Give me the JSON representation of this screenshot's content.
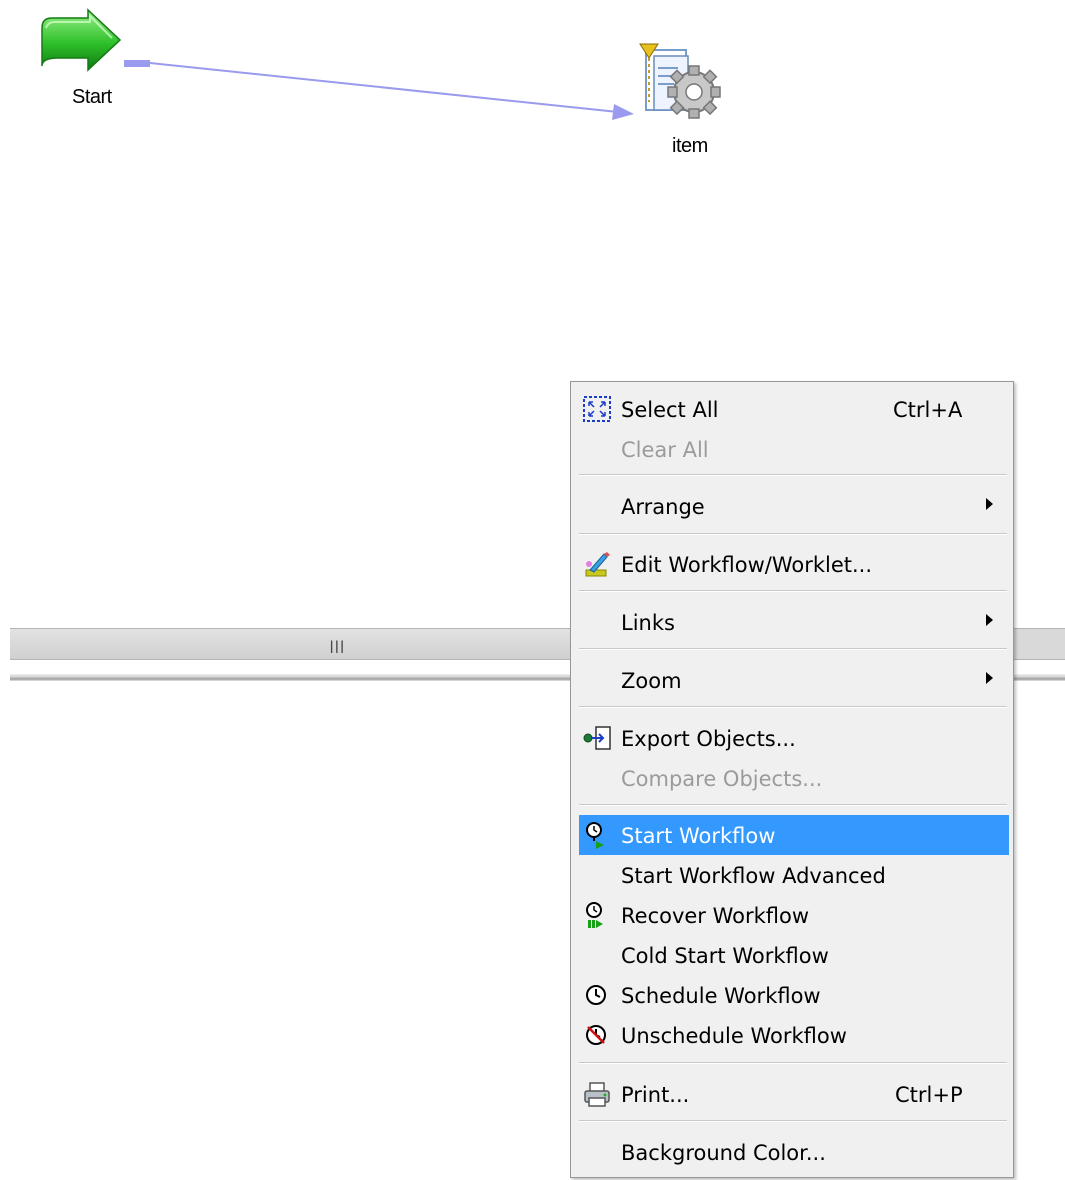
{
  "canvas": {
    "start_node_label": "Start",
    "session_node_label": "item"
  },
  "colors": {
    "link_line": "#9a9aee",
    "menu_highlight": "#3399ff",
    "menu_background": "#f0f0f0",
    "disabled_text": "#9b9b9b"
  },
  "context_menu": {
    "select_all": {
      "label": "Select All",
      "shortcut": "Ctrl+A",
      "icon": "select-all-icon"
    },
    "clear_all": {
      "label": "Clear All"
    },
    "arrange": {
      "label": "Arrange"
    },
    "edit_workflow": {
      "label": "Edit Workflow/Worklet...",
      "icon": "edit-brush-icon"
    },
    "links": {
      "label": "Links"
    },
    "zoom": {
      "label": "Zoom"
    },
    "export_objects": {
      "label": "Export Objects...",
      "icon": "export-icon"
    },
    "compare_objects": {
      "label": "Compare Objects..."
    },
    "start_workflow": {
      "label": "Start Workflow",
      "icon": "start-workflow-icon"
    },
    "start_workflow_advanced": {
      "label": "Start Workflow Advanced"
    },
    "recover_workflow": {
      "label": "Recover Workflow",
      "icon": "recover-workflow-icon"
    },
    "cold_start_workflow": {
      "label": "Cold Start Workflow"
    },
    "schedule_workflow": {
      "label": "Schedule Workflow",
      "icon": "clock-icon"
    },
    "unschedule_workflow": {
      "label": "Unschedule Workflow",
      "icon": "clock-cancel-icon"
    },
    "print": {
      "label": "Print...",
      "shortcut": "Ctrl+P",
      "icon": "printer-icon"
    },
    "background_color": {
      "label": "Background Color..."
    }
  }
}
